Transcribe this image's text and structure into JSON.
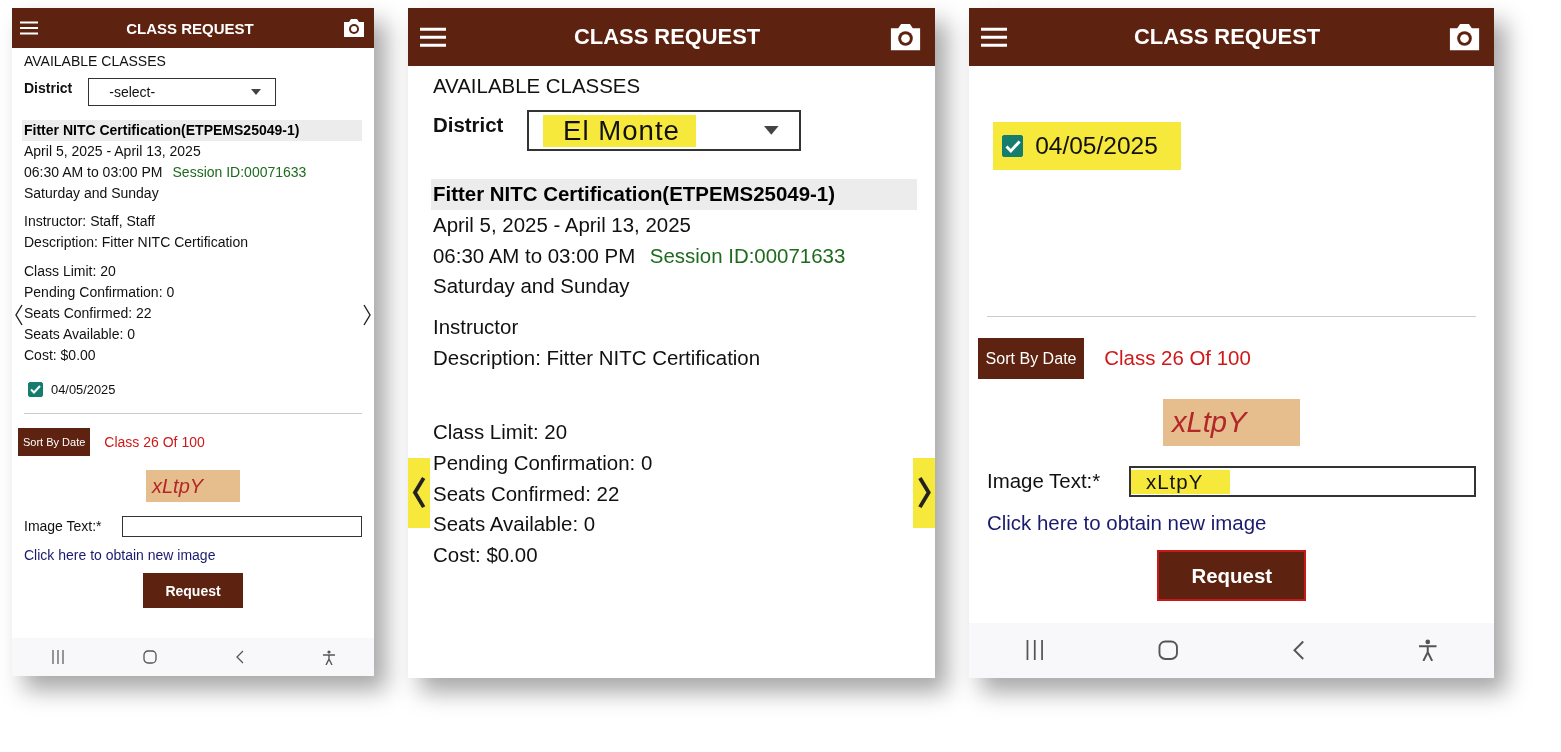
{
  "screens": [
    {
      "header": {
        "title": "CLASS REQUEST"
      },
      "available_heading": "AVAILABLE CLASSES",
      "district": {
        "label": "District",
        "value": "-select-",
        "highlighted": false
      },
      "class_info": {
        "name": "Fitter NITC Certification(ETPEMS25049-1)",
        "dates": "April 5, 2025 - April 13, 2025",
        "time": "06:30 AM to 03:00 PM",
        "session": "Session ID:00071633",
        "days": "Saturday and Sunday",
        "instructor": "Instructor: Staff, Staff",
        "description": "Description: Fitter NITC Certification",
        "stats": [
          "Class Limit: 20",
          "Pending Confirmation: 0",
          "Seats Confirmed: 22",
          "Seats Available: 0",
          "Cost: $0.00"
        ]
      },
      "nav_arrows": {
        "highlighted": false
      },
      "date_option": {
        "label": "04/05/2025",
        "checked": true,
        "highlighted": false
      },
      "sort_button": "Sort By Date",
      "class_count": "Class 26 Of 100",
      "captcha": "xLtpY",
      "image_text": {
        "label": "Image Text:*"
      },
      "new_image_link": "Click here to obtain new image",
      "request_button": {
        "label": "Request",
        "outlined": false
      },
      "system_nav": true
    },
    {
      "header": {
        "title": "CLASS REQUEST"
      },
      "available_heading": "AVAILABLE CLASSES",
      "district": {
        "label": "District",
        "value": "El Monte",
        "highlighted": true
      },
      "class_info": {
        "name": "Fitter NITC Certification(ETPEMS25049-1)",
        "dates": "April 5, 2025 - April 13, 2025",
        "time": "06:30 AM to 03:00 PM",
        "session": "Session ID:00071633",
        "days": "Saturday and Sunday",
        "instructor": "Instructor",
        "description": "Description: Fitter NITC Certification",
        "stats": [
          "Class Limit: 20",
          "Pending Confirmation: 0",
          "Seats Confirmed: 22",
          "Seats Available: 0",
          "Cost: $0.00"
        ]
      },
      "nav_arrows": {
        "highlighted": true
      },
      "system_nav": false
    },
    {
      "header": {
        "title": "CLASS REQUEST"
      },
      "date_option": {
        "label": "04/05/2025",
        "checked": true,
        "highlighted": true
      },
      "sort_button": "Sort By Date",
      "class_count": "Class 26 Of 100",
      "captcha": "xLtpY",
      "image_text": {
        "label": "Image Text:*",
        "value": "xLtpY",
        "highlighted": true
      },
      "new_image_link": "Click here to obtain new image",
      "request_button": {
        "label": "Request",
        "outlined": true
      },
      "system_nav": true
    }
  ]
}
